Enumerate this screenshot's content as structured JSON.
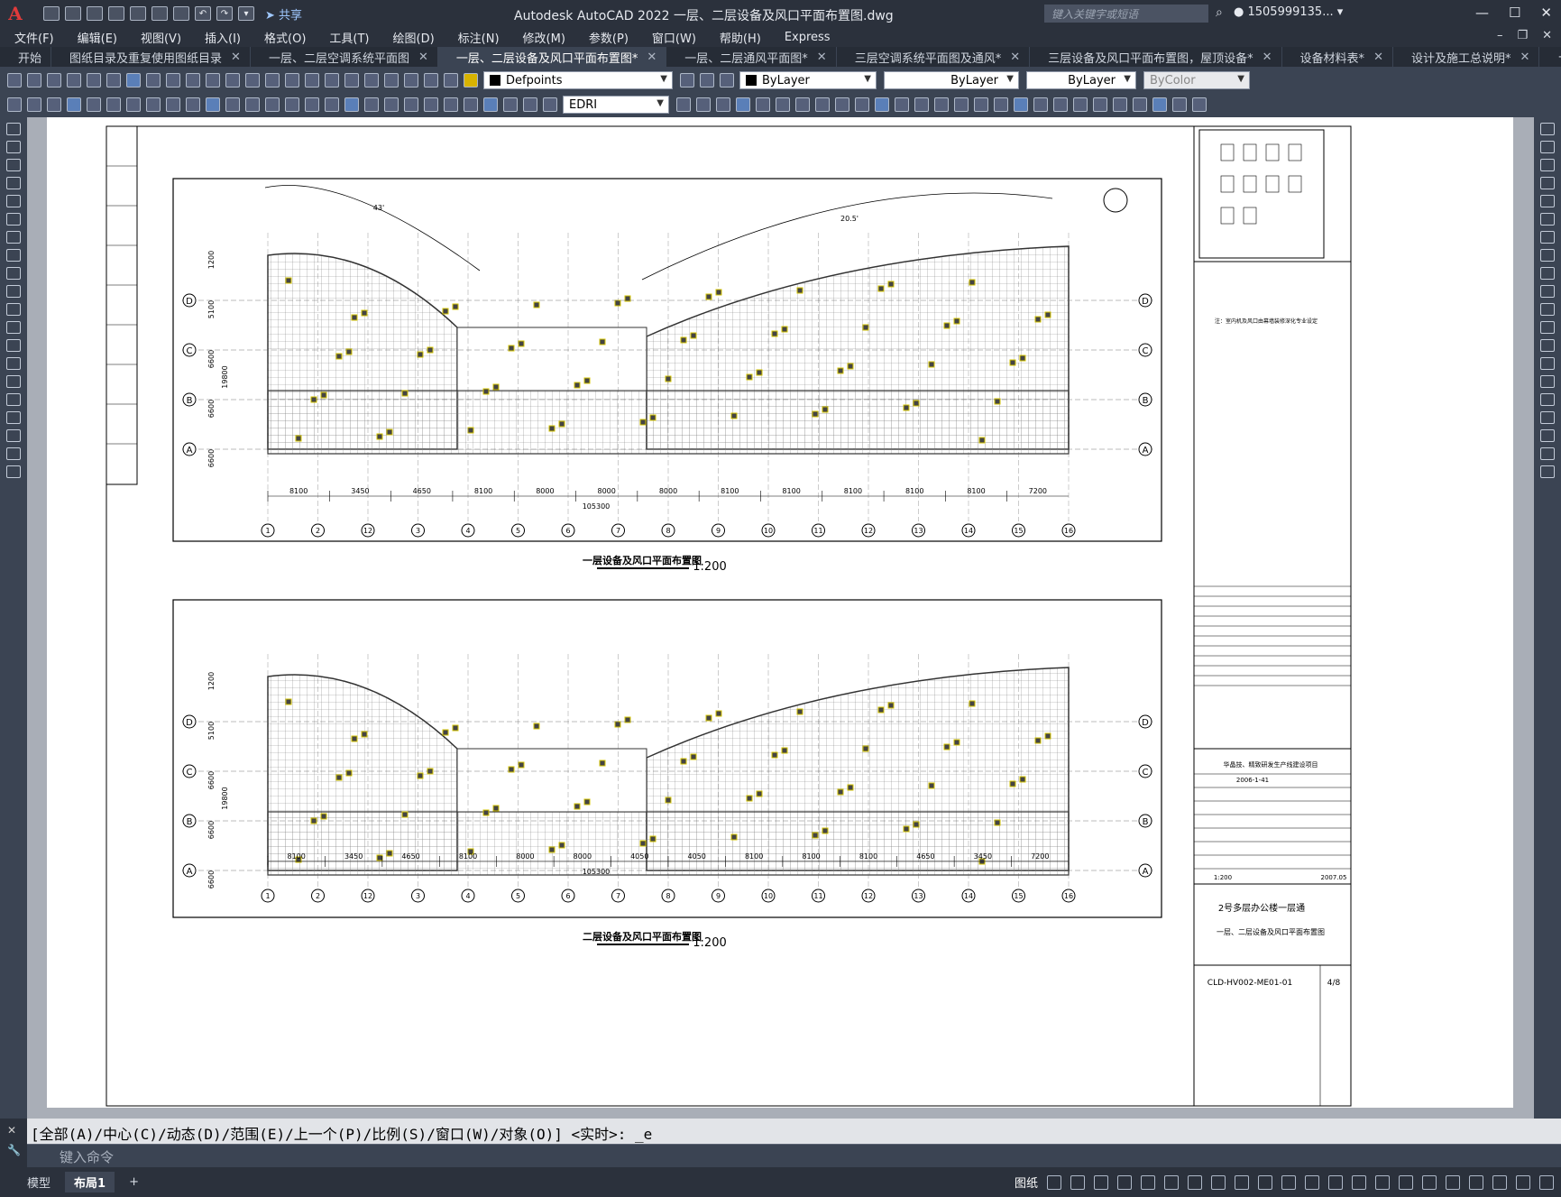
{
  "titlebar": {
    "app_title": "Autodesk AutoCAD 2022    一层、二层设备及风口平面布置图.dwg",
    "share_label": "共享",
    "search_placeholder": "键入关键字或短语",
    "user": "1505999135... ▾"
  },
  "menu": [
    "文件(F)",
    "编辑(E)",
    "视图(V)",
    "插入(I)",
    "格式(O)",
    "工具(T)",
    "绘图(D)",
    "标注(N)",
    "修改(M)",
    "参数(P)",
    "窗口(W)",
    "帮助(H)",
    "Express"
  ],
  "tabs": [
    {
      "label": "开始",
      "closable": false
    },
    {
      "label": "图纸目录及重复使用图纸目录",
      "closable": true
    },
    {
      "label": "一层、二层空调系统平面图",
      "closable": true
    },
    {
      "label": "一层、二层设备及风口平面布置图*",
      "closable": true,
      "active": true
    },
    {
      "label": "一层、二层通风平面图*",
      "closable": true
    },
    {
      "label": "三层空调系统平面图及通风*",
      "closable": true
    },
    {
      "label": "三层设备及风口平面布置图，屋顶设备*",
      "closable": true
    },
    {
      "label": "设备材料表*",
      "closable": true
    },
    {
      "label": "设计及施工总说明*",
      "closable": true
    }
  ],
  "toolbar": {
    "layer": "Defpoints",
    "color": "ByLayer",
    "linetype": "ByLayer",
    "lineweight": "ByLayer",
    "plotstyle": "ByColor",
    "dimstyle": "EDRI"
  },
  "drawing": {
    "plan1_title": "一层设备及风口平面布置图",
    "plan2_title": "二层设备及风口平面布置图",
    "scale": "1:200",
    "total_dim": "105300",
    "dims1": [
      "8100",
      "3450",
      "4650",
      "8100",
      "8000",
      "8000",
      "8000",
      "8100",
      "8100",
      "8100",
      "8100",
      "8100",
      "7200"
    ],
    "dims2": [
      "8100",
      "3450",
      "4650",
      "8100",
      "8000",
      "8000",
      "4050",
      "4050",
      "8100",
      "8100",
      "8100",
      "4650",
      "3450",
      "7200"
    ],
    "grid_nums": [
      "1",
      "2",
      "12",
      "3",
      "4",
      "5",
      "6",
      "7",
      "8",
      "9",
      "10",
      "11",
      "12",
      "13",
      "14",
      "15",
      "16"
    ],
    "grid_rows": [
      "D",
      "C",
      "B",
      "A"
    ],
    "row_dims": [
      "1200",
      "5100",
      "6600",
      "6600",
      "6600"
    ],
    "total_row": "19800",
    "arc_dims": [
      "43'",
      "20.5'"
    ],
    "note": "注：室内机及风口由幕墙装修深化专业设定",
    "title_block": {
      "project": "华晶技、精致研发生产线建设项目",
      "date": "2006-1-41",
      "building": "2号多层办公楼一层通",
      "sheet_name": "一层、二层设备及风口平面布置图",
      "drawing_no": "CLD-HV002-ME01-01",
      "sheet_no": "4/8",
      "scale": "1:200",
      "issue": "2007.05"
    }
  },
  "command": {
    "history": "[全部(A)/中心(C)/动态(D)/范围(E)/上一个(P)/比例(S)/窗口(W)/对象(O)] <实时>: _e",
    "placeholder": "键入命令"
  },
  "status": {
    "model_tab": "模型",
    "layout_tab": "布局1",
    "paper": "图纸"
  }
}
